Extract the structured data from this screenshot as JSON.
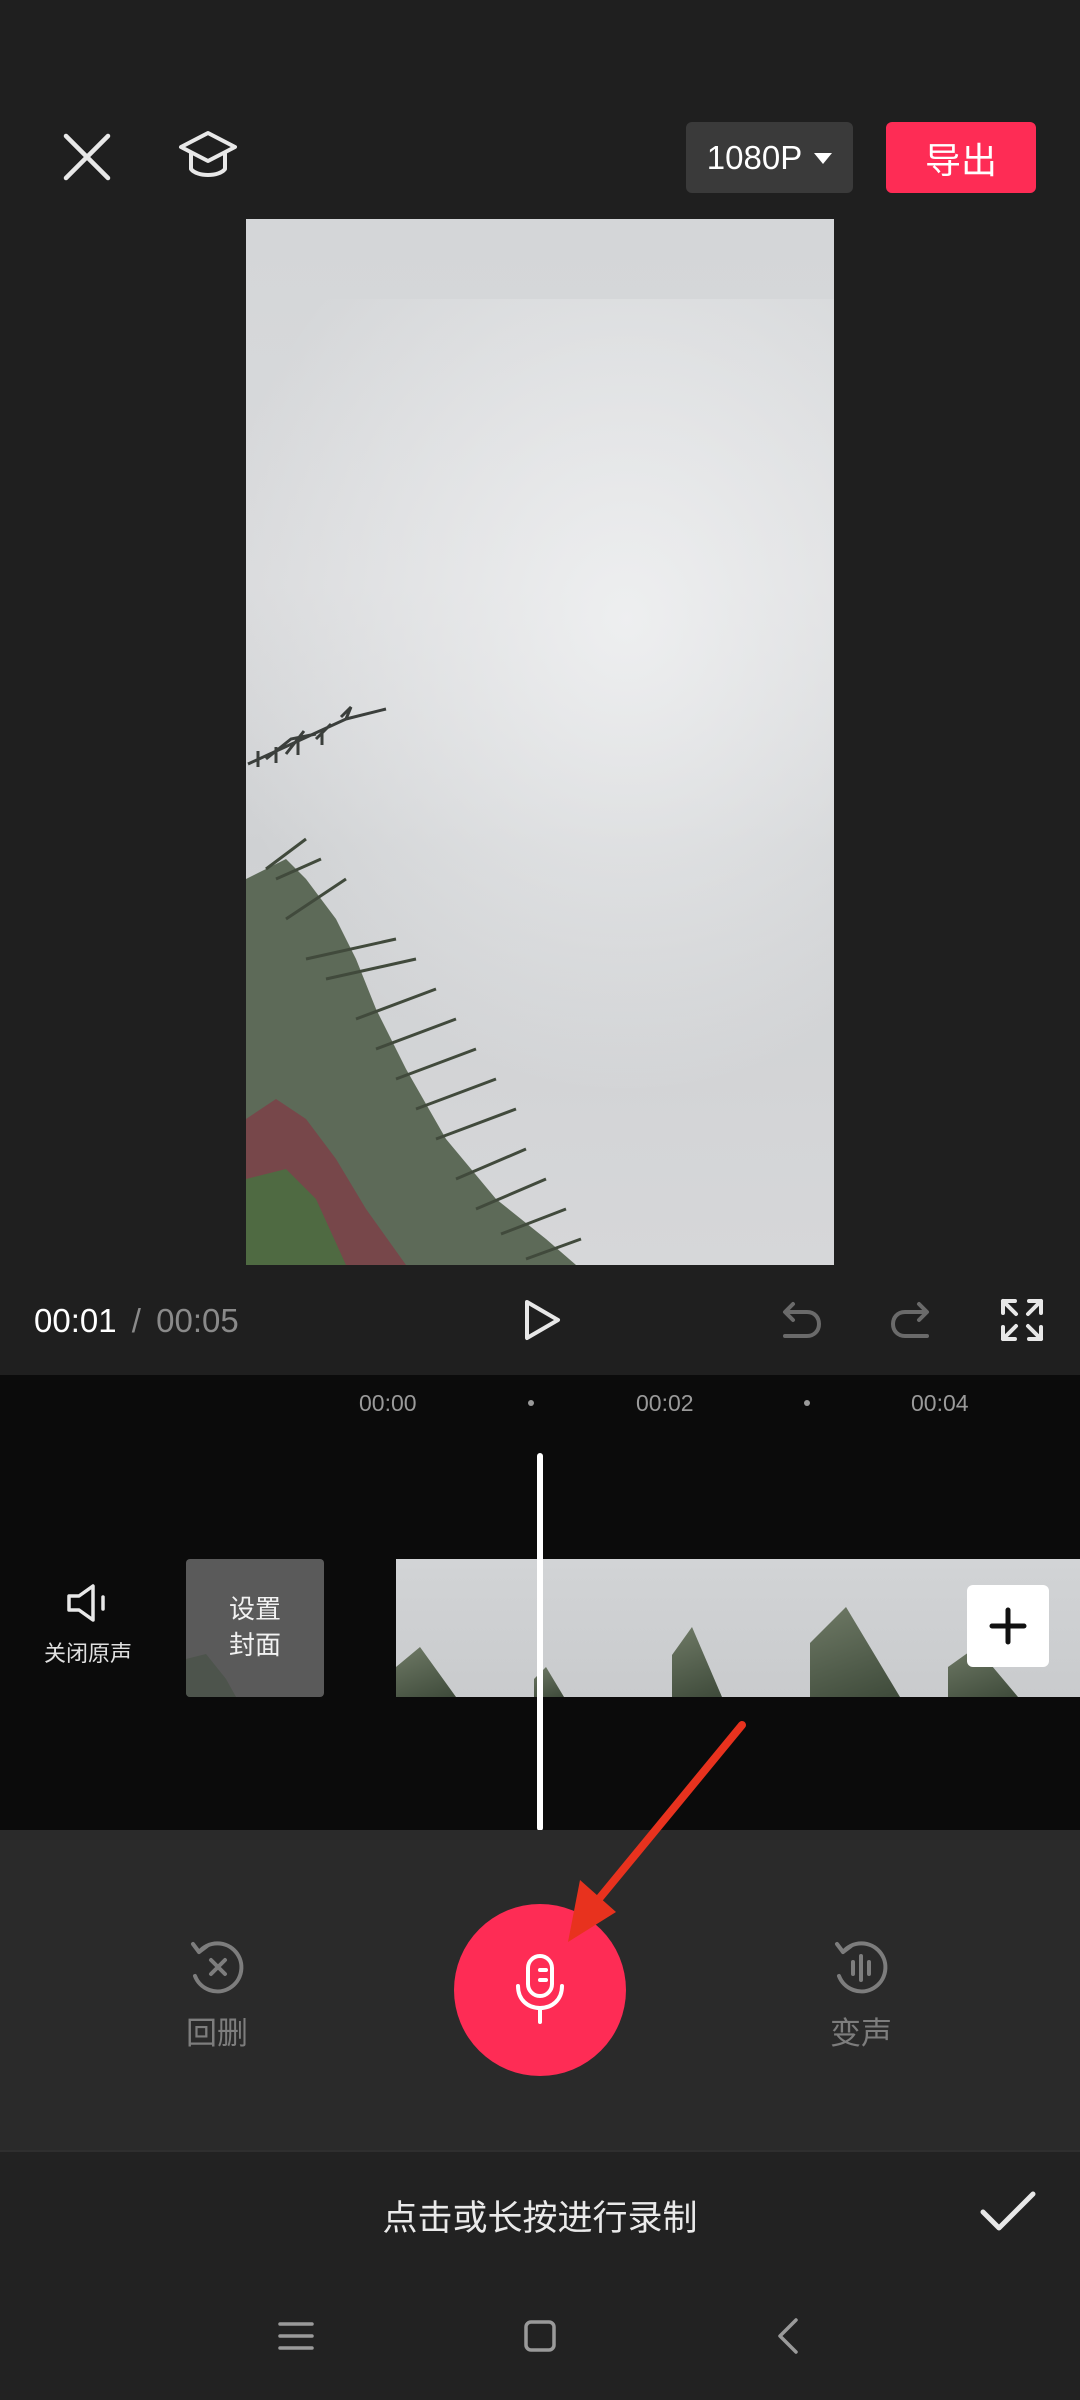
{
  "header": {
    "resolution_label": "1080P",
    "export_label": "导出"
  },
  "playback": {
    "current_time": "00:01",
    "separator": "/",
    "total_time": "00:05"
  },
  "timeline": {
    "ticks": [
      "00:00",
      "00:02",
      "00:04"
    ],
    "mute_label": "关闭原声",
    "cover_label": "设置封面"
  },
  "record_panel": {
    "rewind_label": "回删",
    "voice_change_label": "变声",
    "hint": "点击或长按进行录制"
  },
  "colors": {
    "accent": "#fe2c55",
    "background": "#1f1f1f",
    "timeline_bg": "#0b0b0b",
    "annotation_arrow": "#e8321e"
  },
  "icons": [
    "close-icon",
    "graduation-cap-icon",
    "caret-down-icon",
    "play-icon",
    "undo-icon",
    "redo-icon",
    "fullscreen-icon",
    "speaker-icon",
    "plus-icon",
    "rewind-delete-icon",
    "microphone-icon",
    "voice-change-icon",
    "checkmark-icon",
    "menu-icon",
    "home-icon",
    "back-icon"
  ]
}
